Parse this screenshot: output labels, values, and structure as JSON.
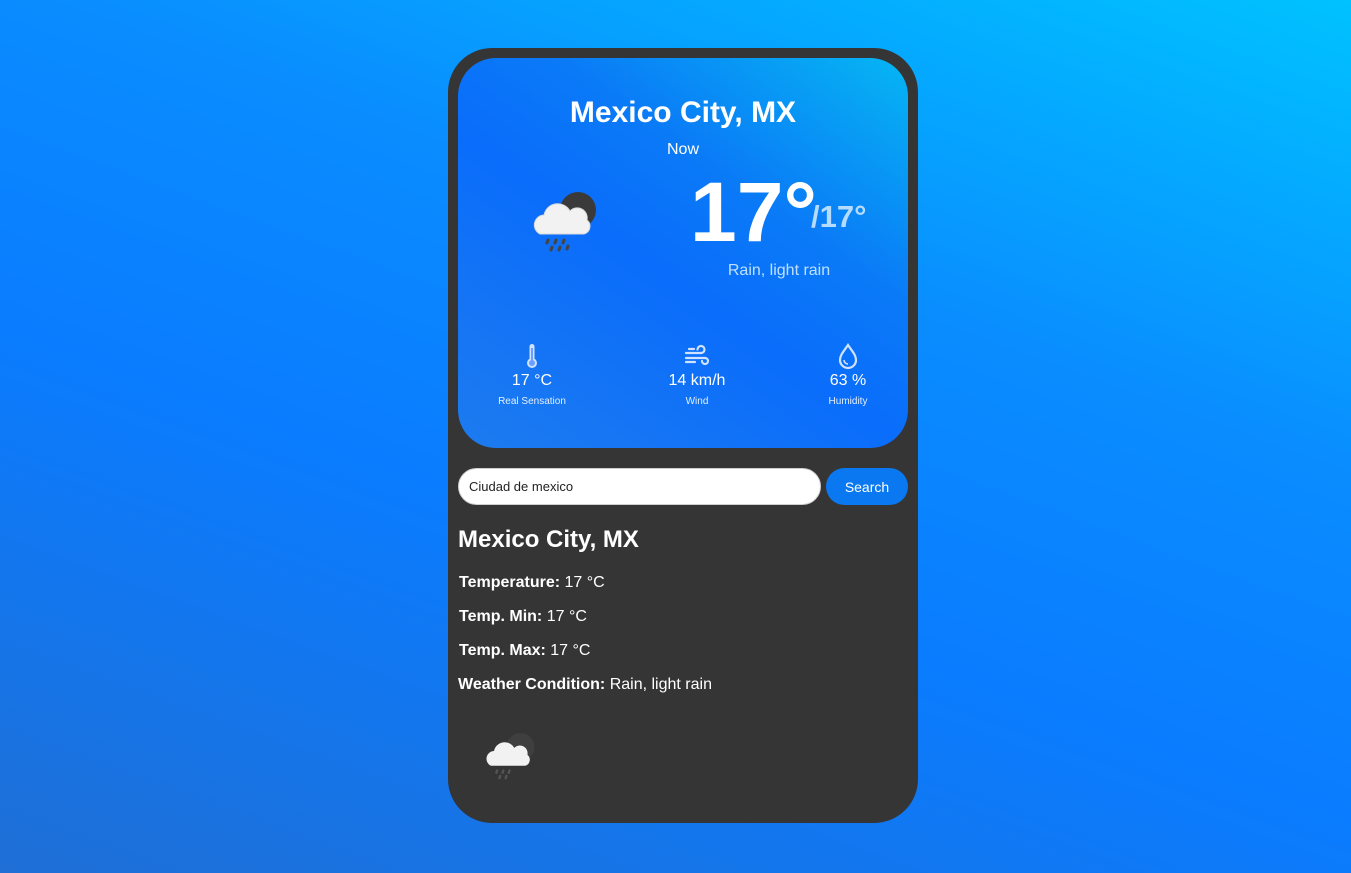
{
  "card": {
    "city": "Mexico City, MX",
    "time_label": "Now",
    "temperature": "17°",
    "temp_max": "/17°",
    "condition": "Rain, light rain",
    "weather_icon": "cloud-moon-rain-icon",
    "stats": [
      {
        "icon": "thermometer-icon",
        "value": "17 °C",
        "label": "Real Sensation"
      },
      {
        "icon": "wind-icon",
        "value": "14 km/h",
        "label": "Wind"
      },
      {
        "icon": "droplet-icon",
        "value": "63 %",
        "label": "Humidity"
      }
    ]
  },
  "search": {
    "value": "Ciudad de mexico",
    "button_label": "Search"
  },
  "details": {
    "city": "Mexico City, MX",
    "temperature_label": "Temperature:",
    "temperature_value": "17 °C",
    "temp_min_label": "Temp. Min:",
    "temp_min_value": "17 °C",
    "temp_max_label": "Temp. Max:",
    "temp_max_value": "17 °C",
    "condition_label": "Weather Condition:",
    "condition_value": "Rain, light rain",
    "weather_icon": "cloud-moon-rain-icon"
  }
}
